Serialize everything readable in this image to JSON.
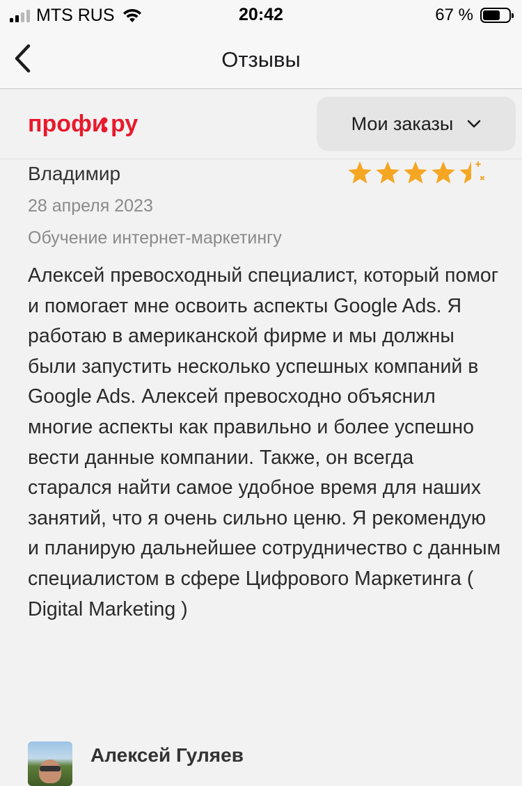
{
  "status_bar": {
    "carrier": "MTS RUS",
    "time": "20:42",
    "battery_percent": "67 %",
    "battery_level": 0.67,
    "signal_bars_active": 2,
    "signal_bars_total": 4
  },
  "nav": {
    "title": "Отзывы",
    "back_icon": "chevron-left-icon"
  },
  "header": {
    "logo_text": "профи.ру",
    "brand_color": "#e8192c",
    "orders_button_label": "Мои заказы",
    "orders_icon": "chevron-down-icon"
  },
  "review": {
    "reviewer_name": "Владимир",
    "rating": 4.5,
    "rating_max": 5,
    "star_color": "#f5a623",
    "date": "28 апреля 2023",
    "service": "Обучение интернет-маркетингу",
    "text": "Алексей превосходный специалист, который помог и помогает мне освоить аспекты Google Ads. Я работаю в американской фирме и мы должны были запустить несколько успешных компаний в Google Ads. Алексей превосходно объяснил многие аспекты как правильно и более успешно вести данные компании. Также, он всегда старался найти самое удобное время для наших занятий, что я очень сильно ценю. Я рекомендую и планирую дальнейшее сотрудничество с данным специалистом в сфере Цифрового Маркетинга ( Digital Marketing )"
  },
  "reply_author": {
    "name": "Алексей Гуляев"
  }
}
